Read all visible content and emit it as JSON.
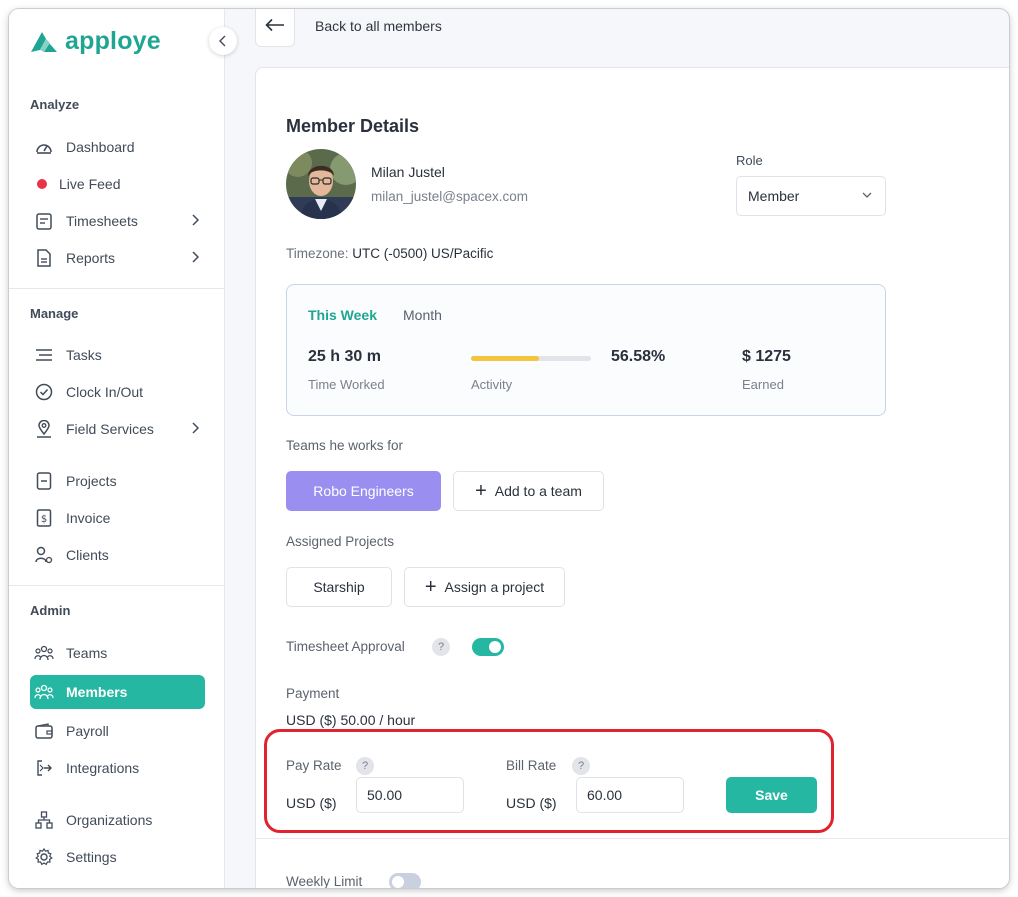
{
  "app": {
    "name": "apploye",
    "brand_color": "#21a593"
  },
  "sidebar": {
    "sections": {
      "analyze": "Analyze",
      "manage": "Manage",
      "admin": "Admin"
    },
    "analyze_items": [
      {
        "label": "Dashboard",
        "icon": "dashboard-icon"
      },
      {
        "label": "Live Feed",
        "icon": "live-dot"
      },
      {
        "label": "Timesheets",
        "icon": "timesheet-icon"
      },
      {
        "label": "Reports",
        "icon": "report-icon"
      }
    ],
    "manage_items": [
      {
        "label": "Tasks",
        "icon": "tasks-icon"
      },
      {
        "label": "Clock In/Out",
        "icon": "clock-icon"
      },
      {
        "label": "Field Services",
        "icon": "location-icon"
      },
      {
        "label": "Projects",
        "icon": "project-icon"
      },
      {
        "label": "Invoice",
        "icon": "invoice-icon"
      },
      {
        "label": "Clients",
        "icon": "clients-icon"
      }
    ],
    "admin_items": [
      {
        "label": "Teams",
        "icon": "teams-icon"
      },
      {
        "label": "Members",
        "icon": "members-icon",
        "active": true
      },
      {
        "label": "Payroll",
        "icon": "wallet-icon"
      },
      {
        "label": "Integrations",
        "icon": "integrations-icon"
      },
      {
        "label": "Organizations",
        "icon": "organizations-icon"
      },
      {
        "label": "Settings",
        "icon": "settings-icon"
      }
    ]
  },
  "topbar": {
    "back_label": "Back to all members"
  },
  "member": {
    "heading": "Member Details",
    "name": "Milan Justel",
    "email": "milan_justel@spacex.com",
    "role_label": "Role",
    "role_value": "Member",
    "timezone_label": "Timezone:",
    "timezone_value": "UTC (-0500) US/Pacific"
  },
  "stats": {
    "tabs": [
      "This Week",
      "Month"
    ],
    "active_tab": "This Week",
    "time_worked_value": "25 h 30 m",
    "time_worked_label": "Time Worked",
    "activity_label": "Activity",
    "activity_percent": "56.58%",
    "activity_fraction": 0.5658,
    "earned_value": "$ 1275",
    "earned_label": "Earned"
  },
  "teams": {
    "label": "Teams he works for",
    "items": [
      "Robo Engineers"
    ],
    "add_label": "Add to a team"
  },
  "projects": {
    "label": "Assigned Projects",
    "items": [
      "Starship"
    ],
    "assign_label": "Assign a project"
  },
  "timesheet_approval": {
    "label": "Timesheet Approval",
    "enabled": true
  },
  "payment": {
    "label": "Payment",
    "summary": "USD ($) 50.00 / hour",
    "pay_rate_label": "Pay Rate",
    "pay_rate_currency": "USD ($)",
    "pay_rate_value": "50.00",
    "bill_rate_label": "Bill Rate",
    "bill_rate_currency": "USD ($)",
    "bill_rate_value": "60.00",
    "save_label": "Save"
  },
  "weekly_limit": {
    "label": "Weekly Limit",
    "enabled": false
  },
  "help_glyph": "?"
}
